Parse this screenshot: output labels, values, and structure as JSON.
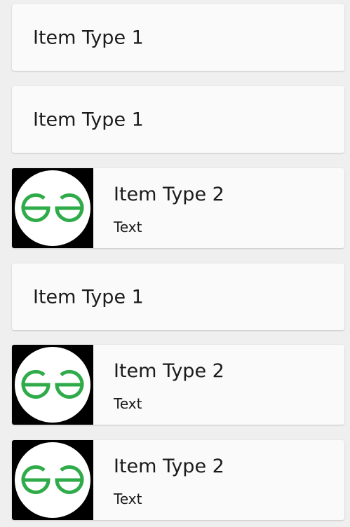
{
  "items": [
    {
      "type": "type1",
      "title": "Item Type 1"
    },
    {
      "type": "type1",
      "title": "Item Type 1"
    },
    {
      "type": "type2",
      "title": "Item Type 2",
      "subtitle": "Text",
      "image": "gfg-logo-icon"
    },
    {
      "type": "type1",
      "title": "Item Type 1"
    },
    {
      "type": "type2",
      "title": "Item Type 2",
      "subtitle": "Text",
      "image": "gfg-logo-icon"
    },
    {
      "type": "type2",
      "title": "Item Type 2",
      "subtitle": "Text",
      "image": "gfg-logo-icon"
    }
  ],
  "colors": {
    "background": "#efefef",
    "card": "#fafafa",
    "logo_green": "#2fab4a",
    "thumb_bg": "#000000"
  }
}
